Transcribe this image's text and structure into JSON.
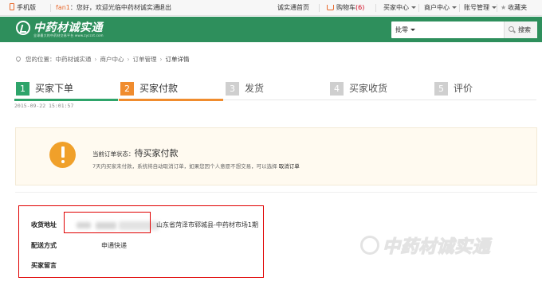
{
  "topbar": {
    "mobile_label": "手机版",
    "username": "fan1",
    "greeting": "您好，欢迎光临中药材诚实通",
    "logout": "退出",
    "home": "诚实通首页",
    "cart_label": "购物车",
    "cart_count": "(6)",
    "buyer_center": "买家中心",
    "merchant_center": "商户中心",
    "account": "账号管理",
    "favorites": "收藏夹"
  },
  "header": {
    "logo_text": "中药材诚实通",
    "logo_sub": "全球最大的中药材交易平台 www.zyccst.com",
    "search_type": "批零",
    "search_placeholder": "",
    "search_button": "搜索"
  },
  "breadcrumb": {
    "prefix": "您的位置：",
    "items": [
      "中药材诚实通",
      "商户中心",
      "订单管理"
    ],
    "current": "订单详情",
    "separator": "›"
  },
  "steps": [
    {
      "num": "1",
      "label": "买家下单",
      "state": "done"
    },
    {
      "num": "2",
      "label": "买家付款",
      "state": "active"
    },
    {
      "num": "3",
      "label": "发货",
      "state": "todo"
    },
    {
      "num": "4",
      "label": "买家收货",
      "state": "todo"
    },
    {
      "num": "5",
      "label": "评价",
      "state": "todo"
    }
  ],
  "step_date": "2015-09-22 15:01:57",
  "status": {
    "prefix": "当前订单状态：",
    "value": "待买家付款",
    "note": "7天内买家未付款，系统将自动取消订单，如果您因个人意愿不想交易，可以选择",
    "cancel_link": "取消订单"
  },
  "info": {
    "address_label": "收货地址",
    "address_value": "山东省菏泽市郓城县-中药材市场1期",
    "delivery_label": "配送方式",
    "delivery_value": "申通快递",
    "message_label": "买家留言"
  },
  "watermark_text": "中药材诚实通",
  "colors": {
    "brand_green": "#2e8f5c",
    "step_done": "#2ea46a",
    "step_active": "#f08c2e",
    "step_todo": "#cfcfcf",
    "annotation_red": "#e00000",
    "warning_orange": "#f0a02a"
  }
}
